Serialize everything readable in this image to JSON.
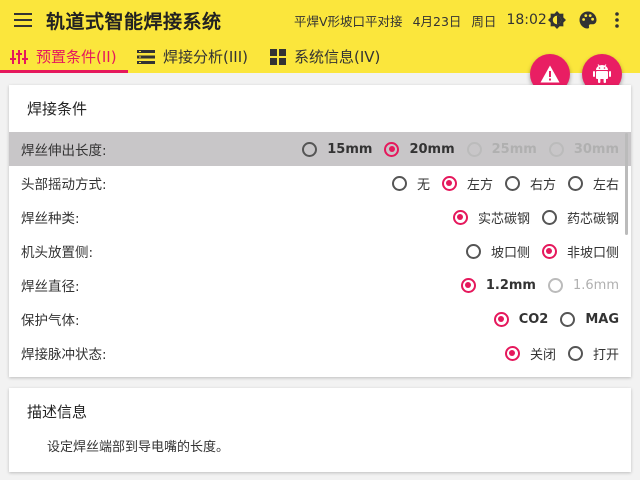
{
  "app": {
    "title": "轨道式智能焊接系统",
    "weld_type": "平焊V形坡口平对接",
    "date": "4月23日",
    "weekday": "周日",
    "time": "18:02"
  },
  "tabs": [
    {
      "label": "预置条件(II)",
      "icon": "sliders-icon",
      "active": true
    },
    {
      "label": "焊接分析(III)",
      "icon": "list-icon",
      "active": false
    },
    {
      "label": "系统信息(IV)",
      "icon": "grid-icon",
      "active": false
    }
  ],
  "fabs": [
    {
      "icon": "warning-icon"
    },
    {
      "icon": "android-icon"
    }
  ],
  "conditions": {
    "title": "焊接条件",
    "rows": [
      {
        "label": "焊丝伸出长度:",
        "selected": true,
        "options": [
          {
            "label": "15mm",
            "checked": false,
            "disabled": false,
            "bold": true
          },
          {
            "label": "20mm",
            "checked": true,
            "disabled": false,
            "bold": true
          },
          {
            "label": "25mm",
            "checked": false,
            "disabled": true,
            "bold": true
          },
          {
            "label": "30mm",
            "checked": false,
            "disabled": true,
            "bold": true
          }
        ]
      },
      {
        "label": "头部摇动方式:",
        "selected": false,
        "options": [
          {
            "label": "无",
            "checked": false,
            "disabled": false
          },
          {
            "label": "左方",
            "checked": true,
            "disabled": false
          },
          {
            "label": "右方",
            "checked": false,
            "disabled": false
          },
          {
            "label": "左右",
            "checked": false,
            "disabled": false
          }
        ]
      },
      {
        "label": "焊丝种类:",
        "selected": false,
        "options": [
          {
            "label": "实芯碳钢",
            "checked": true,
            "disabled": false
          },
          {
            "label": "药芯碳钢",
            "checked": false,
            "disabled": false
          }
        ]
      },
      {
        "label": "机头放置侧:",
        "selected": false,
        "options": [
          {
            "label": "坡口侧",
            "checked": false,
            "disabled": false
          },
          {
            "label": "非坡口侧",
            "checked": true,
            "disabled": false
          }
        ]
      },
      {
        "label": "焊丝直径:",
        "selected": false,
        "options": [
          {
            "label": "1.2mm",
            "checked": true,
            "disabled": false,
            "bold": true
          },
          {
            "label": "1.6mm",
            "checked": false,
            "disabled": true
          }
        ]
      },
      {
        "label": "保护气体:",
        "selected": false,
        "options": [
          {
            "label": "CO2",
            "checked": true,
            "disabled": false,
            "bold": true
          },
          {
            "label": "MAG",
            "checked": false,
            "disabled": false,
            "bold": true
          }
        ]
      },
      {
        "label": "焊接脉冲状态:",
        "selected": false,
        "options": [
          {
            "label": "关闭",
            "checked": true,
            "disabled": false
          },
          {
            "label": "打开",
            "checked": false,
            "disabled": false
          }
        ]
      }
    ]
  },
  "description": {
    "title": "描述信息",
    "text": "设定焊丝端部到导电嘴的长度。"
  },
  "colors": {
    "appbar": "#fbe63c",
    "accent": "#e5185c",
    "fab": "#e91e63",
    "selected_row": "#c8c6c8"
  }
}
